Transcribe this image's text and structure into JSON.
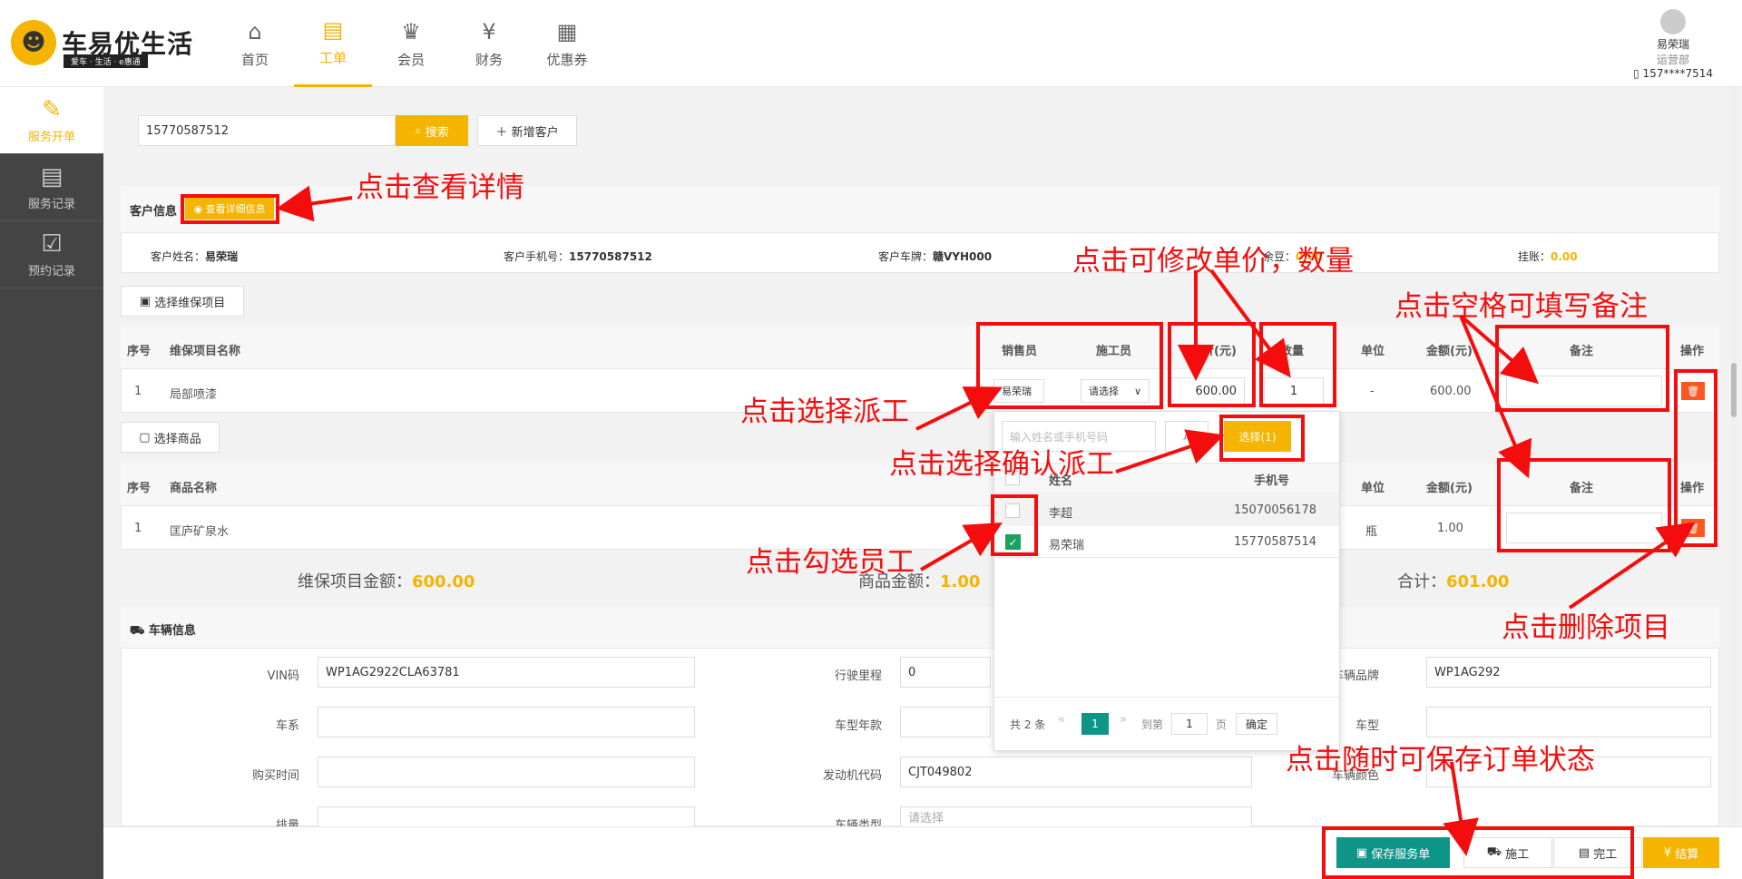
{
  "brand": {
    "name": "车易优生活",
    "tagline": "爱车 · 生活 · e惠通"
  },
  "nav": [
    {
      "label": "首页",
      "icon": "home-icon"
    },
    {
      "label": "工单",
      "icon": "clipboard-icon"
    },
    {
      "label": "会员",
      "icon": "crown-icon"
    },
    {
      "label": "财务",
      "icon": "finance-icon"
    },
    {
      "label": "优惠券",
      "icon": "coupon-icon"
    }
  ],
  "user": {
    "name": "易荣瑞",
    "dept": "运营部",
    "phone": "157****7514"
  },
  "sidebar": [
    {
      "label": "服务开单"
    },
    {
      "label": "服务记录"
    },
    {
      "label": "预约记录"
    }
  ],
  "search": {
    "value": "15770587512",
    "button": "搜索",
    "add_button": "新增客户"
  },
  "customer": {
    "section_title": "客户信息",
    "detail_button": "查看详细信息",
    "name_label": "客户姓名：",
    "name": "易荣瑞",
    "phone_label": "客户手机号：",
    "phone": "15770587512",
    "plate_label": "客户车牌：",
    "plate": "赣VYH000",
    "balance_label": "余豆：",
    "balance": "0.00",
    "credit_label": "挂账：",
    "credit": "0.00"
  },
  "service_table": {
    "select_button": "选择维保项目",
    "headers": [
      "序号",
      "维保项目名称",
      "销售员",
      "施工员",
      "单价(元)",
      "数量",
      "单位",
      "金额(元)",
      "备注",
      "操作"
    ],
    "rows": [
      {
        "no": "1",
        "name": "局部喷漆",
        "seller": "易荣瑞",
        "worker": "请选择",
        "price": "600.00",
        "qty": "1",
        "unit": "-",
        "amount": "600.00"
      }
    ]
  },
  "goods_table": {
    "select_button": "选择商品",
    "headers": [
      "序号",
      "商品名称",
      "单位",
      "金额(元)",
      "备注",
      "操作"
    ],
    "rows": [
      {
        "no": "1",
        "name": "匡庐矿泉水",
        "unit": "瓶",
        "amount": "1.00"
      }
    ]
  },
  "totals": {
    "service_label": "维保项目金额：",
    "service": "600.00",
    "goods_label": "商品金额：",
    "goods": "1.00",
    "total_label": "合计：",
    "total": "601.00"
  },
  "dispatch_popup": {
    "search_placeholder": "输入姓名或手机号码",
    "select_button": "选择(1)",
    "headers": [
      "姓名",
      "手机号"
    ],
    "rows": [
      {
        "name": "李超",
        "phone": "15070056178",
        "checked": false
      },
      {
        "name": "易荣瑞",
        "phone": "15770587514",
        "checked": true
      }
    ],
    "pager": {
      "total": "共 2 条",
      "page": "1",
      "goto_label": "到第",
      "goto_value": "1",
      "page_unit": "页",
      "confirm": "确定"
    }
  },
  "vehicle": {
    "section_title": "车辆信息",
    "fields": {
      "vin_label": "VIN码",
      "vin": "WP1AG2922CLA63781",
      "mileage_label": "行驶里程",
      "mileage": "0",
      "brand_label": "车辆品牌",
      "brand": "WP1AG292",
      "series_label": "车系",
      "series": "",
      "model_year_label": "车型年款",
      "model_year": "",
      "model_label": "车型",
      "model": "",
      "buy_date_label": "购买时间",
      "buy_date": "",
      "engine_label": "发动机代码",
      "engine": "CJT049802",
      "color_label": "车辆颜色",
      "color": "",
      "displacement_label": "排量",
      "displacement": "",
      "type_label": "车辆类型",
      "type_placeholder": "请选择"
    }
  },
  "actions": {
    "save": "保存服务单",
    "construct": "施工",
    "complete": "完工",
    "settle": "结算"
  },
  "annotations": {
    "view_detail": "点击查看详情",
    "edit_price": "点击可修改单价，数量",
    "remark": "点击空格可填写备注",
    "dispatch": "点击选择派工",
    "confirm_dispatch": "点击选择确认派工",
    "check_staff": "点击勾选员工",
    "delete": "点击删除项目",
    "save_anytime": "点击随时可保存订单状态"
  },
  "colors": {
    "accent": "#f4b400",
    "primary": "#0f9488",
    "annotation": "#f50d0d",
    "danger": "#ff5722"
  }
}
